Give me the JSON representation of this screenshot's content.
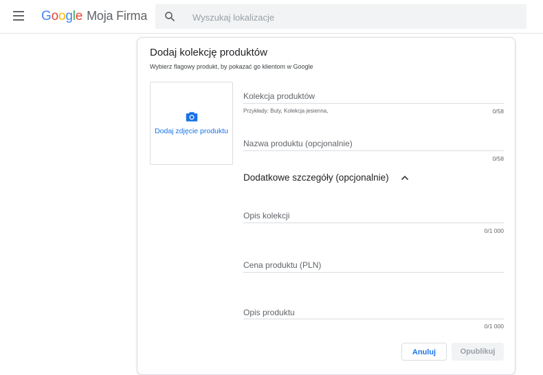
{
  "header": {
    "logo_letters": [
      "G",
      "o",
      "o",
      "g",
      "l",
      "e"
    ],
    "product_name": "Moja Firma",
    "search_placeholder": "Wyszukaj lokalizacje"
  },
  "card": {
    "title": "Dodaj kolekcję produktów",
    "subtitle": "Wybierz flagowy produkt, by pokazać go klientom w Google",
    "photo_label": "Dodaj zdjęcie produktu",
    "fields": {
      "collection": {
        "label": "Kolekcja produktów",
        "hint": "Przykłady: Buty, Kolekcja jesienna,",
        "count": "0/58"
      },
      "product_name": {
        "label": "Nazwa produktu (opcjonalnie)",
        "count": "0/58"
      },
      "collection_desc": {
        "label": "Opis kolekcji",
        "count": "0/1 000"
      },
      "price": {
        "label": "Cena produktu (PLN)"
      },
      "product_desc": {
        "label": "Opis produktu",
        "count": "0/1 000"
      }
    },
    "details_section_title": "Dodatkowe szczegóły (opcjonalnie)",
    "buttons": {
      "cancel": "Anuluj",
      "publish": "Opublikuj"
    }
  },
  "colors": {
    "accent": "#1a73e8",
    "border": "#dadce0",
    "text": "#3c4043"
  },
  "icons": {
    "menu": "hamburger-icon",
    "search": "search-icon",
    "camera": "camera-icon",
    "chevron": "chevron-up-icon"
  }
}
